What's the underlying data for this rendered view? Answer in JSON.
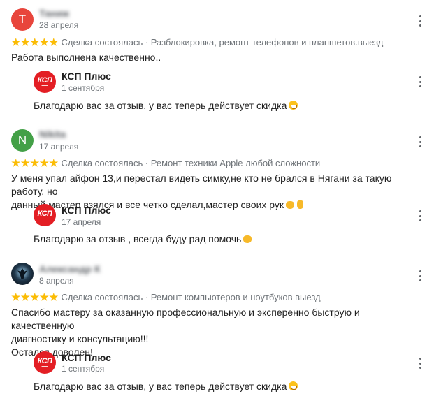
{
  "colors": {
    "star": "#fbbc04",
    "avatar_t": "#e8453c",
    "avatar_n": "#43a047",
    "brand_red": "#e31e24"
  },
  "reviews": [
    {
      "avatar_letter": "Т",
      "author": "Таниж",
      "date": "28 апреля",
      "rating": 5,
      "deal_status": "Сделка состоялась",
      "service": "Разблокировка, ремонт телефонов и планшетов.выезд",
      "text_lines": [
        "Работа выполнена качественно.."
      ],
      "reply": {
        "logo_text": "КСП",
        "name": "КСП Плюс",
        "date": "1 сентября",
        "text": "Благодарю вас за отзыв, у вас теперь действует скидка",
        "emoji": "grinning-face-icon"
      }
    },
    {
      "avatar_letter": "N",
      "author": "Nikita",
      "date": "17 апреля",
      "rating": 5,
      "deal_status": "Сделка состоялась",
      "service": "Ремонт техники Apple любой сложности",
      "text_lines": [
        "У меня упал айфон 13,и перестал видеть симку,не кто не брался в Нягани за такую работу, но",
        "данный мастер взялся и все четко сделал,мастер своих рук"
      ],
      "reply": {
        "logo_text": "КСП",
        "name": "КСП Плюс",
        "date": "17 апреля",
        "text": "Благодарю за отзыв , всегда буду рад помочь",
        "emoji": "handshake-icon"
      }
    },
    {
      "avatar_letter": "",
      "author": "Александр К",
      "date": "8 апреля",
      "rating": 5,
      "deal_status": "Сделка состоялась",
      "service": "Ремонт компьютеров и ноутбуков выезд",
      "text_lines": [
        "Спасибо мастеру за оказанную профессиональную и эксперенно быструю и качественную",
        "диагностику и консультацию!!!",
        "Остался доволен!"
      ],
      "reply": {
        "logo_text": "КСП",
        "name": "КСП Плюс",
        "date": "1 сентября",
        "text": "Благодарю вас за отзыв, у вас теперь действует скидка",
        "emoji": "grinning-face-icon"
      }
    }
  ]
}
